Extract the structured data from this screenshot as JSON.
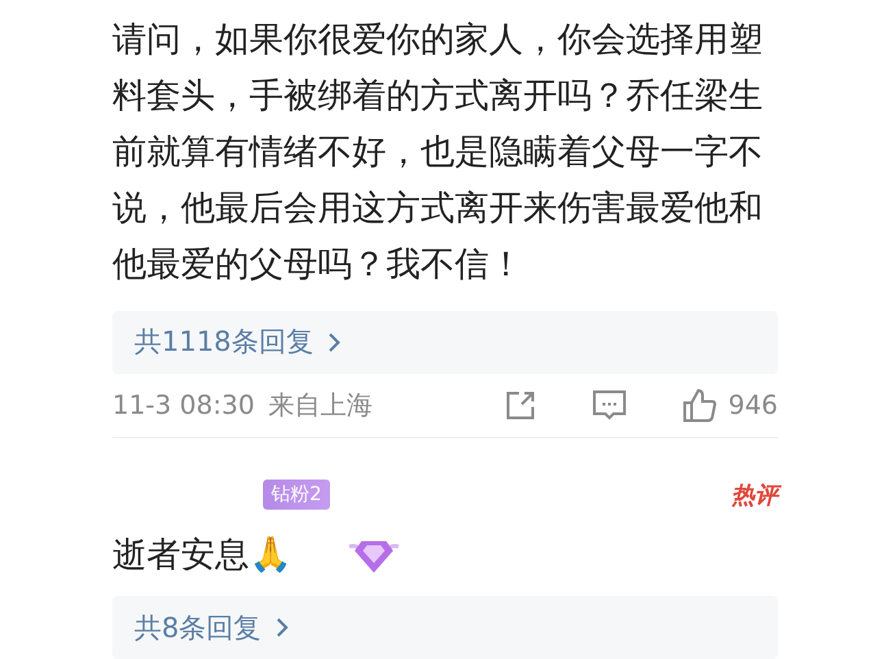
{
  "comments": [
    {
      "text": "请问，如果你很爱你的家人，你会选择用塑料套头，手被绑着的方式离开吗？乔任梁生前就算有情绪不好，也是隐瞒着父母一字不说，他最后会用这方式离开来伤害最爱他和他最爱的父母吗？我不信！",
      "replies": "共1118条回复",
      "time": "11-3 08:30",
      "location": "来自上海",
      "likes": "946"
    },
    {
      "badge": "钻粉2",
      "tag": "热评",
      "text": "逝者安息🙏",
      "replies": "共8条回复"
    }
  ]
}
